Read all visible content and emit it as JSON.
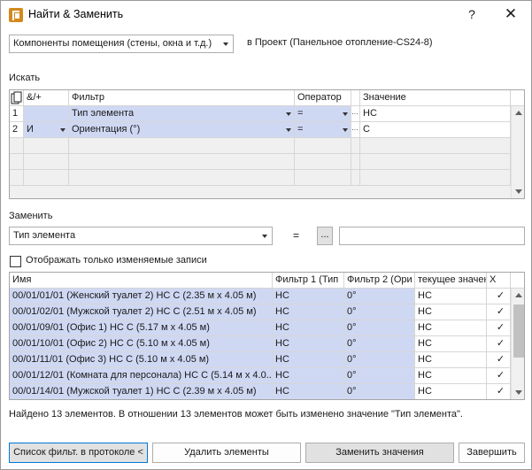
{
  "window": {
    "title": "Найти & Заменить",
    "help": "?",
    "close": "✕"
  },
  "scope": {
    "category": "Компоненты помещения (стены, окна и т.д.)",
    "project": "в Проект (Панельное отопление-CS24-8)"
  },
  "search": {
    "section_label": "Искать",
    "headers": {
      "andor": "&/+",
      "filter": "Фильтр",
      "operator": "Оператор",
      "value": "Значение"
    },
    "rows": [
      {
        "num": "1",
        "andor": "",
        "filter": "Тип элемента",
        "operator": "=",
        "dots": "···",
        "value": "НС"
      },
      {
        "num": "2",
        "andor": "И",
        "filter": "Ориентация (°)",
        "operator": "=",
        "dots": "···",
        "value": "С"
      }
    ]
  },
  "replace": {
    "section_label": "Заменить",
    "field": "Тип элемента",
    "equals": "=",
    "browse": "...",
    "value": ""
  },
  "only_changed": {
    "label": "Отображать только изменяемые записи",
    "checked": false
  },
  "results": {
    "headers": {
      "name": "Имя",
      "f1": "Фильтр 1 (Тип",
      "f2": "Фильтр 2 (Ори",
      "current": "текущее значен",
      "x": "X"
    },
    "rows": [
      {
        "name": "00/01/01/01 (Женский туалет 2) НС С (2.35 м x 4.05 м)",
        "f1": "НС",
        "f2": "0°",
        "current": "НС",
        "mark": "✓"
      },
      {
        "name": "00/01/02/01 (Мужской туалет 2) НС С (2.51 м x 4.05 м)",
        "f1": "НС",
        "f2": "0°",
        "current": "НС",
        "mark": "✓"
      },
      {
        "name": "00/01/09/01 (Офис 1) НС С (5.17 м x 4.05 м)",
        "f1": "НС",
        "f2": "0°",
        "current": "НС",
        "mark": "✓"
      },
      {
        "name": "00/01/10/01 (Офис 2) НС С (5.10 м x 4.05 м)",
        "f1": "НС",
        "f2": "0°",
        "current": "НС",
        "mark": "✓"
      },
      {
        "name": "00/01/11/01 (Офис 3) НС С (5.10 м x 4.05 м)",
        "f1": "НС",
        "f2": "0°",
        "current": "НС",
        "mark": "✓"
      },
      {
        "name": "00/01/12/01 (Комната для персонала) НС С (5.14 м x 4.0...",
        "f1": "НС",
        "f2": "0°",
        "current": "НС",
        "mark": "✓"
      },
      {
        "name": "00/01/14/01 (Мужской туалет 1) НС С (2.39 м x 4.05 м)",
        "f1": "НС",
        "f2": "0°",
        "current": "НС",
        "mark": "✓"
      }
    ]
  },
  "status": "Найдено 13 элементов. В отношении 13 элементов может быть изменено значение \"Тип элемента\".",
  "buttons": {
    "filter_list": "Список фильт. в протоколе <",
    "delete": "Удалить элементы",
    "replace": "Заменить значения",
    "finish": "Завершить"
  },
  "colors": {
    "highlight": "#cfd8f3",
    "default_border": "#0078d7"
  }
}
